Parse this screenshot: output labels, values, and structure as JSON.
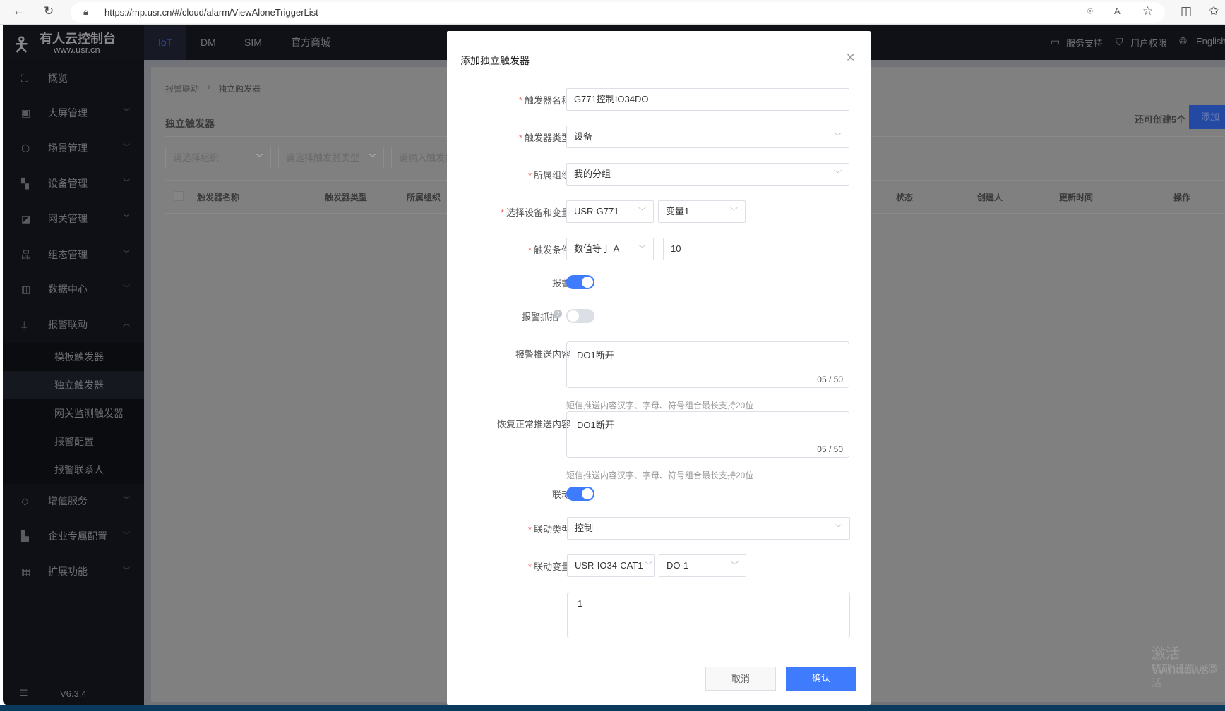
{
  "browser": {
    "url": "https://mp.usr.cn/#/cloud/alarm/ViewAloneTriggerList"
  },
  "app": {
    "logo_title": "有人云控制台",
    "logo_sub": "www.usr.cn",
    "top_tabs": [
      "IoT",
      "DM",
      "SIM",
      "官方商城"
    ],
    "top_right": {
      "support": "服务支持",
      "permissions": "用户权限",
      "language": "English"
    }
  },
  "sidebar": {
    "items": [
      {
        "label": "概览",
        "icon": "overview-icon"
      },
      {
        "label": "大屏管理",
        "icon": "screen-icon"
      },
      {
        "label": "场景管理",
        "icon": "scene-icon"
      },
      {
        "label": "设备管理",
        "icon": "device-icon"
      },
      {
        "label": "网关管理",
        "icon": "gateway-icon"
      },
      {
        "label": "组态管理",
        "icon": "topology-icon"
      },
      {
        "label": "数据中心",
        "icon": "chart-icon"
      },
      {
        "label": "报警联动",
        "icon": "alarm-icon"
      }
    ],
    "sub_items": [
      "模板触发器",
      "独立触发器",
      "网关监测触发器",
      "报警配置",
      "报警联系人"
    ],
    "items2": [
      {
        "label": "增值服务"
      },
      {
        "label": "企业专属配置"
      },
      {
        "label": "扩展功能"
      }
    ],
    "version": "V6.3.4"
  },
  "page": {
    "breadcrumb": [
      "报警联动",
      "独立触发器"
    ],
    "title": "独立触发器",
    "remaining": "还可创建5个",
    "add_label": "添加",
    "filters": [
      "请选择组织",
      "请选择触发器类型",
      "请输入触发器"
    ],
    "columns": [
      "触发器名称",
      "触发器类型",
      "所属组织",
      "状态",
      "创建人",
      "更新时间",
      "操作"
    ]
  },
  "modal": {
    "title": "添加独立触发器",
    "name_label": "触发器名称",
    "name_value": "G771控制IO34DO",
    "type_label": "触发器类型",
    "type_value": "设备",
    "org_label": "所属组织",
    "org_value": "我的分组",
    "device_label": "选择设备和变量",
    "device_value": "USR-G771",
    "variable_value": "变量1",
    "condition_label": "触发条件",
    "condition_value": "数值等于 A",
    "condition_input": "10",
    "alarm_label": "报警",
    "alarm_on": true,
    "snapshot_label": "报警抓拍",
    "snapshot_on": false,
    "push_label": "报警推送内容",
    "push_value": "DO1断开",
    "push_count": "05 / 50",
    "hint": "短信推送内容汉字、字母、符号组合最长支持20位",
    "recover_label": "恢复正常推送内容",
    "recover_value": "DO1断开",
    "recover_count": "05 / 50",
    "hint2": "短信推送内容汉字、字母、符号组合最长支持20位",
    "linkage_label": "联动",
    "linkage_on": true,
    "link_type_label": "联动类型",
    "link_type_value": "控制",
    "link_var_label": "联动变量",
    "link_device_value": "USR-IO34-CAT1",
    "link_var_value": "DO-1",
    "link_value": "1",
    "cancel": "取消",
    "confirm": "确认"
  },
  "watermark": {
    "line1": "激活 Windows",
    "line2": "转到\"设置\"以激活"
  },
  "colors": {
    "primary": "#3f7bfd",
    "sidebar": "#0f1015"
  }
}
